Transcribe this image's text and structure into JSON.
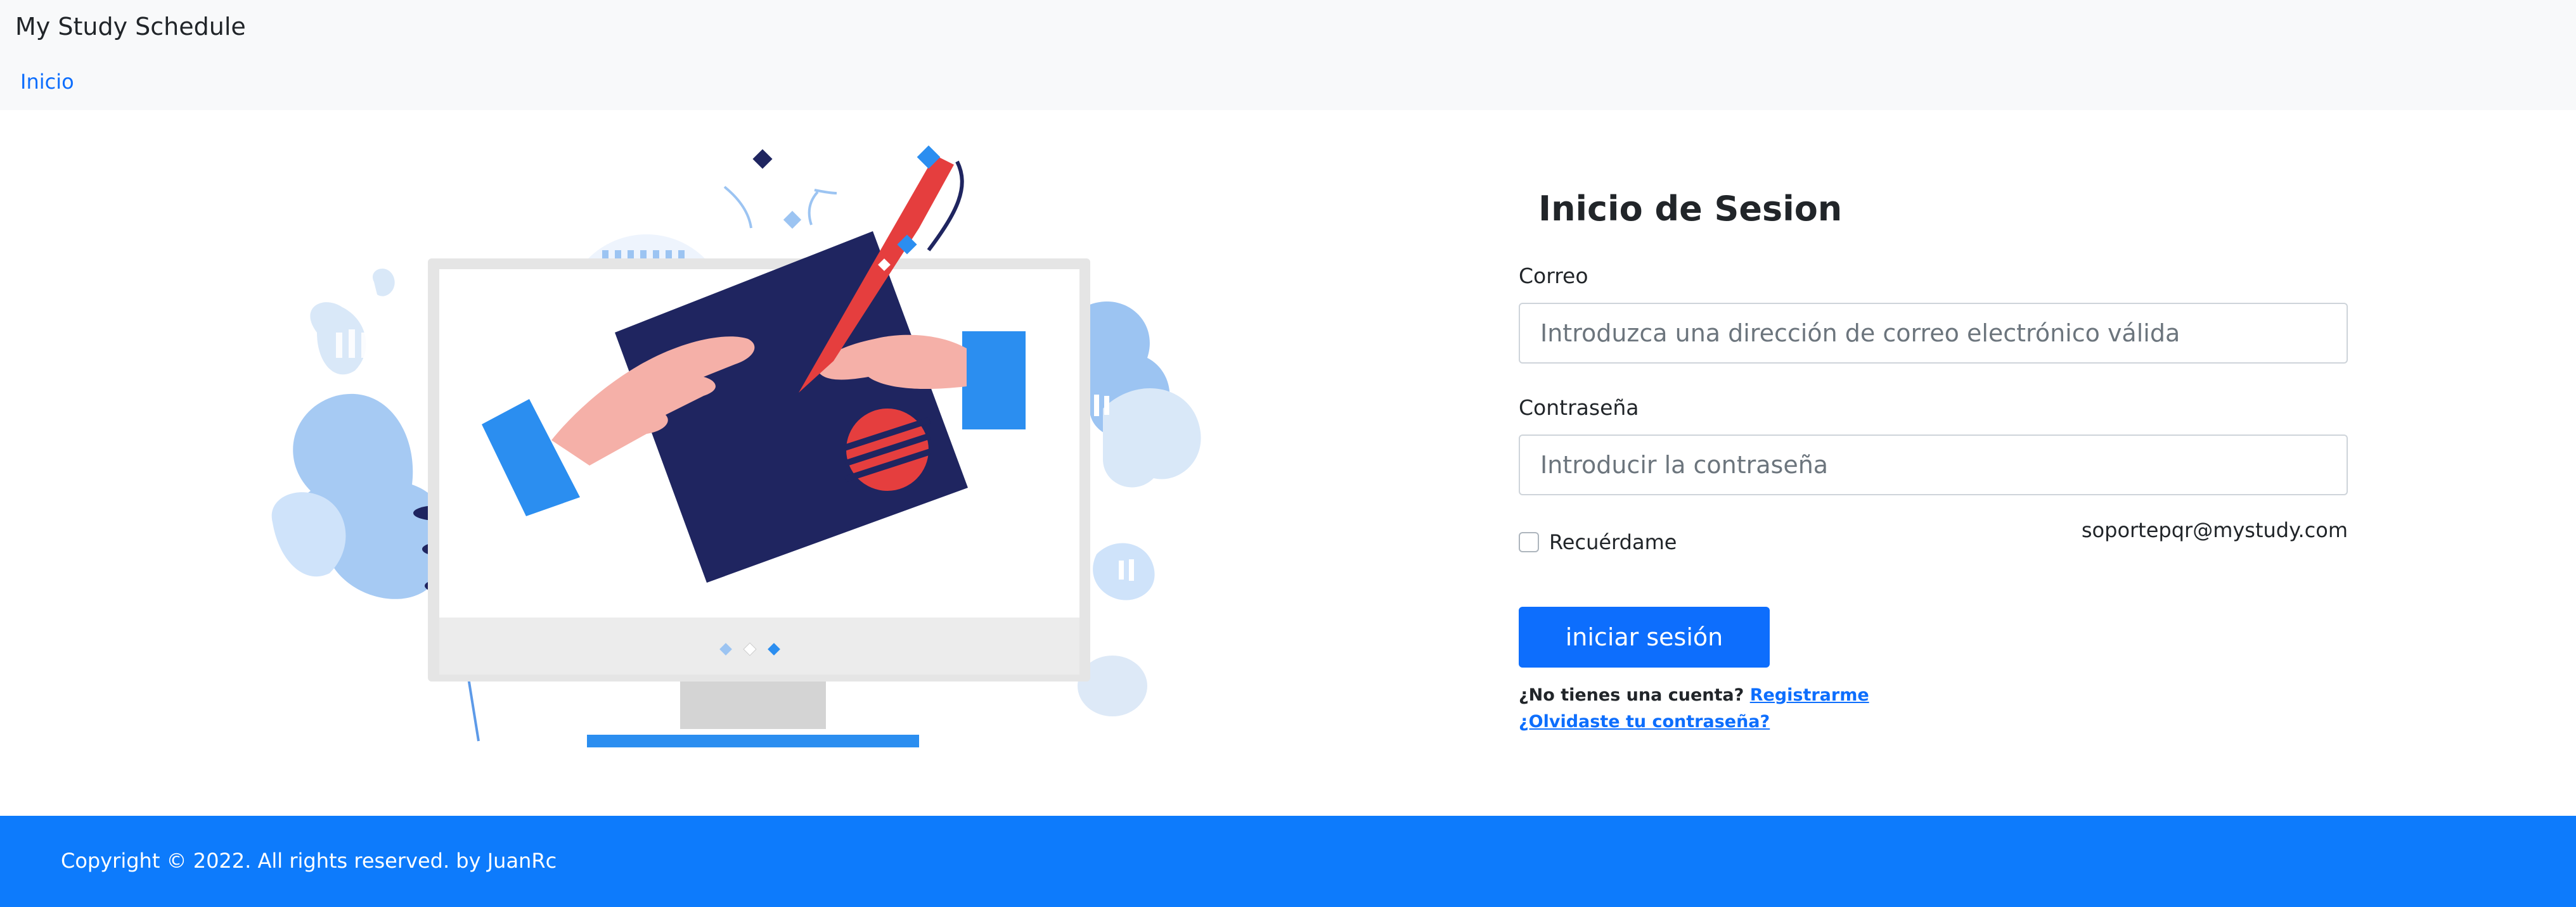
{
  "navbar": {
    "brand": "My Study Schedule",
    "links": [
      "Inicio"
    ]
  },
  "login": {
    "title": "Inicio de Sesion",
    "email_label": "Correo",
    "email_placeholder": "Introduzca una dirección de correo electrónico válida",
    "password_label": "Contraseña",
    "password_placeholder": "Introducir la contraseña",
    "remember_label": "Recuérdame",
    "support_email": "soportepqr@mystudy.com",
    "submit_label": "iniciar sesión",
    "no_account_text": "¿No tienes una cuenta?",
    "register_link": "Registrarme",
    "forgot_link": "¿Olvidaste tu contraseña?"
  },
  "footer": {
    "copyright": "Copyright © 2022. All rights reserved. by JuanRc"
  },
  "colors": {
    "primary": "#0d6efd",
    "footer_bg": "#0d7bfc",
    "navbar_bg": "#f8f9fa",
    "illustration_navy": "#1f2560",
    "illustration_red": "#e53e3e",
    "illustration_blue": "#2b8ef0",
    "illustration_light_blue": "#9cc4f2",
    "illustration_skin": "#f5b0a8"
  },
  "icons": {
    "illustration": "monitor-drawing-illustration",
    "checkbox": "checkbox-unchecked"
  }
}
